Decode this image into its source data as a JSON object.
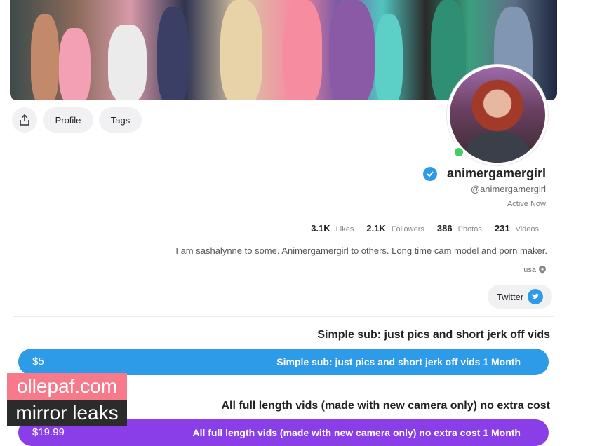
{
  "profile": {
    "display_name": "animergamergirl",
    "handle": "@animergamergirl",
    "status": "Active Now",
    "bio": "I am sashalynne to some. Animergamergirl to others. Long time cam model and porn maker.",
    "location": "usa"
  },
  "nav": {
    "profile_label": "Profile",
    "tags_label": "Tags"
  },
  "stats": {
    "likes": "3.1K",
    "likes_label": "Likes",
    "followers": "2.1K",
    "followers_label": "Followers",
    "photos": "386",
    "photos_label": "Photos",
    "videos": "231",
    "videos_label": "Videos"
  },
  "social": {
    "twitter_label": "Twitter"
  },
  "tiers": [
    {
      "title": "Simple sub: just pics and short jerk off vids",
      "button_label": "Simple sub: just pics and short jerk off vids 1 Month",
      "price": "$5",
      "color": "#2e9be8"
    },
    {
      "title": "All full length vids (made with new camera only) no extra cost",
      "button_label": "All full length vids (made with new camera only) no extra cost 1 Month",
      "price": "$19.99",
      "color": "#8a3ee8"
    }
  ],
  "watermark": {
    "line1": "ollepaf.com",
    "line2": "mirror leaks"
  },
  "colors": {
    "accent": "#2e9be8",
    "online": "#3fcf62",
    "watermark_pink": "#f77a8a"
  },
  "icons": [
    "share-icon",
    "verified-icon",
    "location-pin-icon",
    "twitter-bird-icon"
  ]
}
